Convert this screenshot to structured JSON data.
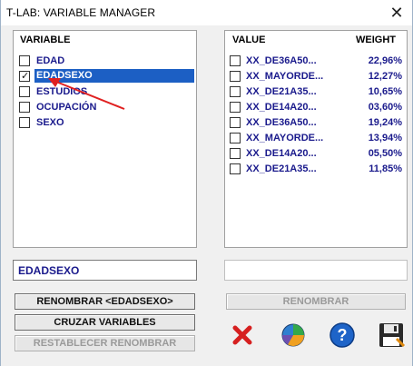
{
  "window": {
    "title": "T-LAB: VARIABLE MANAGER"
  },
  "left_panel": {
    "header": "VARIABLE",
    "items": [
      {
        "label": "EDAD",
        "checked": false,
        "selected": false
      },
      {
        "label": "EDADSEXO",
        "checked": true,
        "selected": true
      },
      {
        "label": "ESTUDIOS",
        "checked": false,
        "selected": false
      },
      {
        "label": "OCUPACIÓN",
        "checked": false,
        "selected": false
      },
      {
        "label": "SEXO",
        "checked": false,
        "selected": false
      }
    ]
  },
  "right_panel": {
    "header_value": "VALUE",
    "header_weight": "WEIGHT",
    "rows": [
      {
        "value": "XX_DE36A50...",
        "weight": "22,96%"
      },
      {
        "value": "XX_MAYORDE...",
        "weight": "12,27%"
      },
      {
        "value": "XX_DE21A35...",
        "weight": "10,65%"
      },
      {
        "value": "XX_DE14A20...",
        "weight": "03,60%"
      },
      {
        "value": "XX_DE36A50...",
        "weight": "19,24%"
      },
      {
        "value": "XX_MAYORDE...",
        "weight": "13,94%"
      },
      {
        "value": "XX_DE14A20...",
        "weight": "05,50%"
      },
      {
        "value": "XX_DE21A35...",
        "weight": "11,85%"
      }
    ]
  },
  "name_field": {
    "value": "EDADSEXO"
  },
  "rename_field": {
    "value": ""
  },
  "buttons": {
    "rename_var": "RENOMBRAR <EDADSEXO>",
    "cross_vars": "CRUZAR VARIABLES",
    "reset_rename": "RESTABLECER RENOMBRAR",
    "rename_value": "RENOMBRAR"
  },
  "icons": {
    "delete": "red-x-icon",
    "chart": "pie-chart-icon",
    "help": "help-icon",
    "save": "save-icon"
  },
  "colors": {
    "selection": "#1c5fc4",
    "text_blue": "#1a1a8c",
    "arrow": "#e02020"
  }
}
